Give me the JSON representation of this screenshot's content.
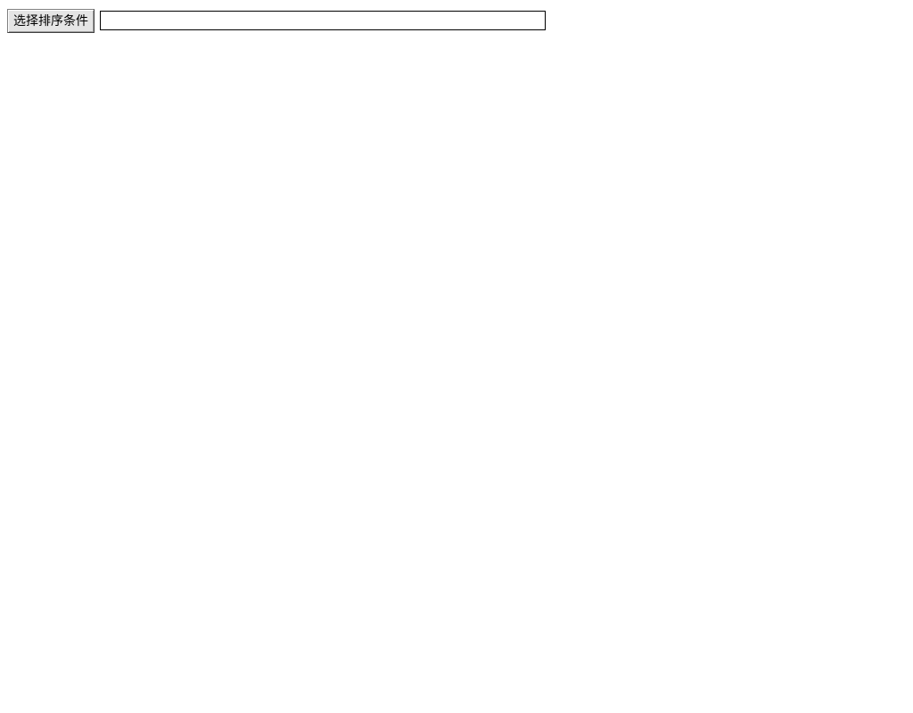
{
  "toolbar": {
    "sort_button_label": "选择排序条件",
    "input_value": "",
    "input_placeholder": ""
  }
}
